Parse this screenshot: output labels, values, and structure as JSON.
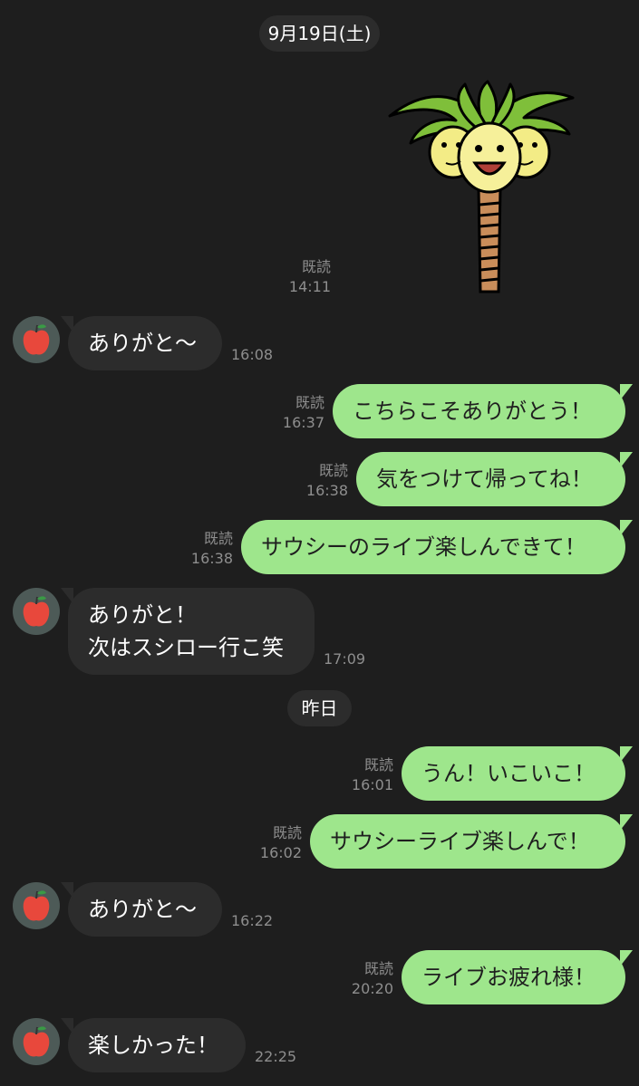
{
  "dates": {
    "first": "9月19日(土)",
    "second": "昨日"
  },
  "read_label": "既読",
  "colors": {
    "background": "#1e1e1e",
    "incoming_bubble": "#2c2c2c",
    "outgoing_bubble": "#9ee68c",
    "avatar_bg": "#4d5a57"
  },
  "sticker": {
    "icon": "palm-tree-exeggutor-sticker",
    "time": "14:11"
  },
  "avatar_icon": "apple-icon",
  "messages": [
    {
      "dir": "in",
      "text": "ありがと〜",
      "time": "16:08"
    },
    {
      "dir": "out",
      "text": "こちらこそありがとう！",
      "time": "16:37"
    },
    {
      "dir": "out",
      "text": "気をつけて帰ってね！",
      "time": "16:38"
    },
    {
      "dir": "out",
      "text": "サウシーのライブ楽しんできて！",
      "time": "16:38"
    },
    {
      "dir": "in",
      "lines": [
        "ありがと！",
        "次はスシロー行こ笑"
      ],
      "time": "17:09"
    },
    {
      "dir": "out",
      "text": "うん！いこいこ！",
      "time": "16:01"
    },
    {
      "dir": "out",
      "text": "サウシーライブ楽しんで！",
      "time": "16:02"
    },
    {
      "dir": "in",
      "text": "ありがと〜",
      "time": "16:22"
    },
    {
      "dir": "out",
      "text": "ライブお疲れ様！",
      "time": "20:20"
    },
    {
      "dir": "in",
      "text": "楽しかった！",
      "time": "22:25"
    }
  ]
}
